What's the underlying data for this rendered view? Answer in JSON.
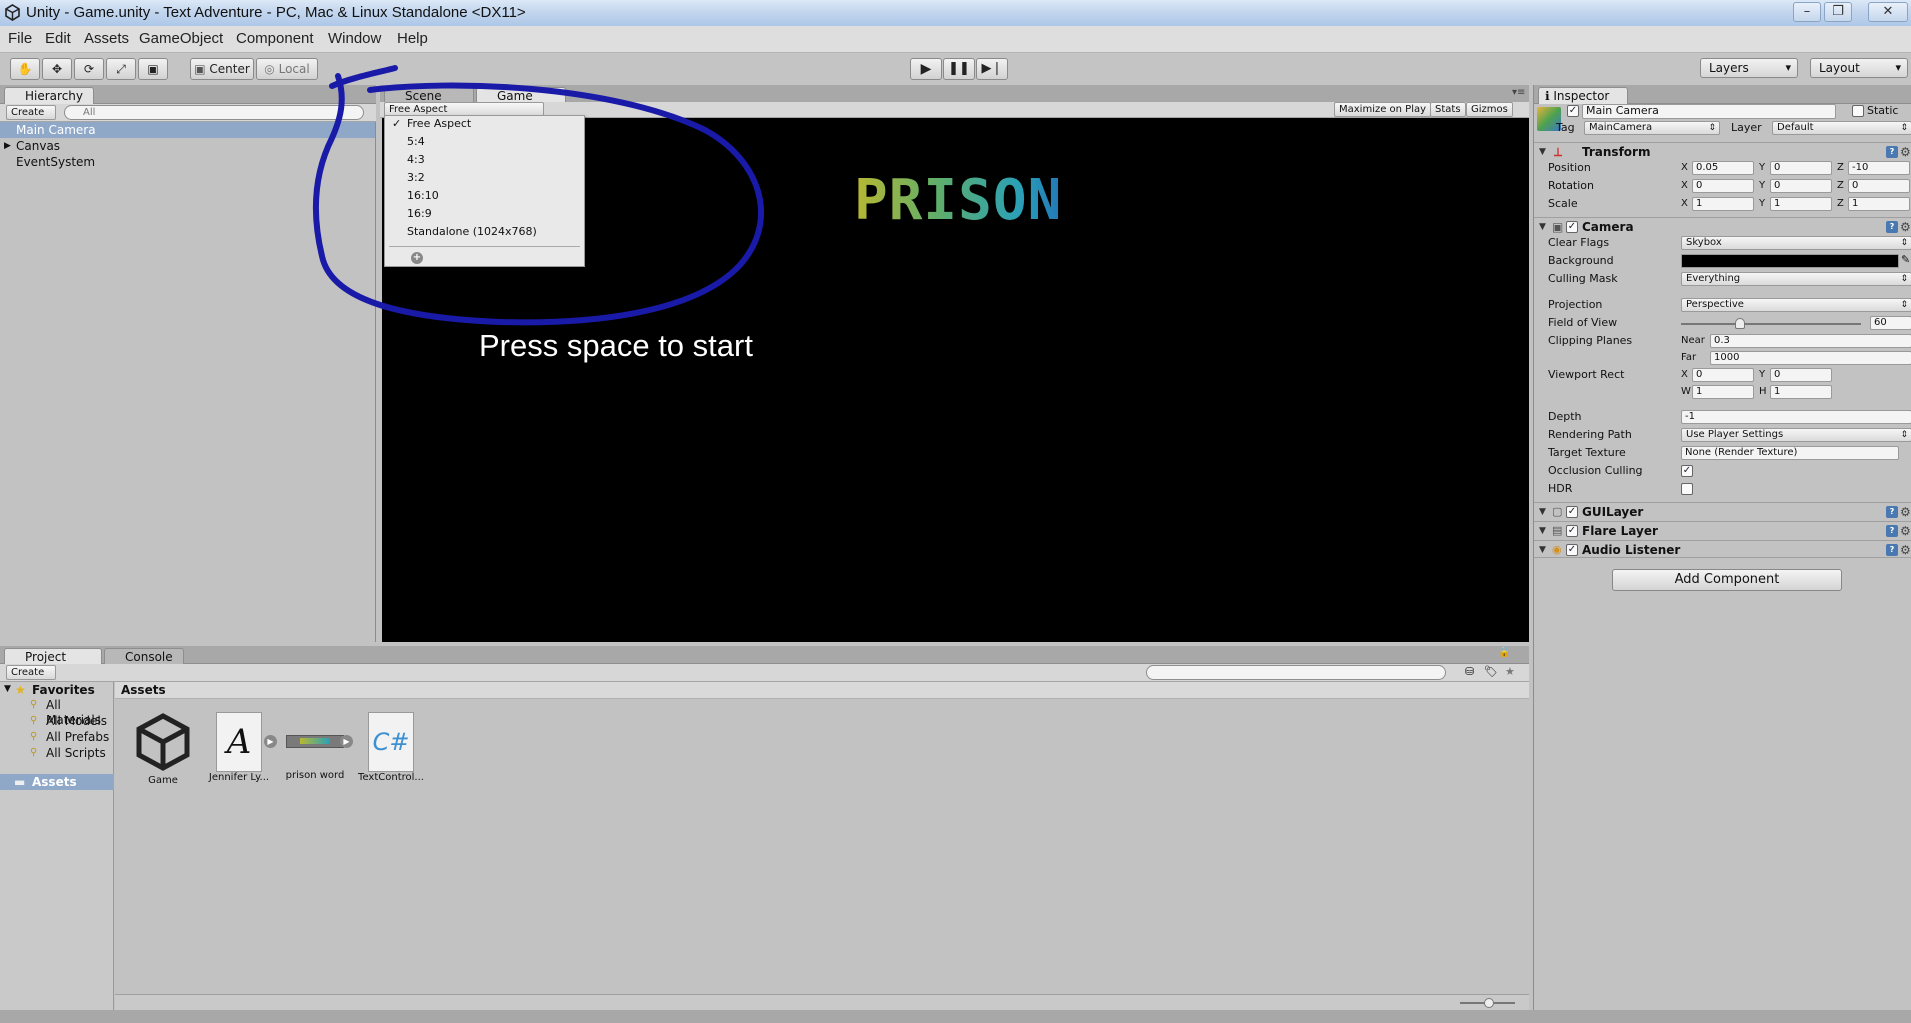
{
  "window": {
    "title": "Unity - Game.unity - Text Adventure - PC, Mac & Linux Standalone <DX11>",
    "minimize": "–",
    "maximize": "❐",
    "close": "✕"
  },
  "menu": [
    "File",
    "Edit",
    "Assets",
    "GameObject",
    "Component",
    "Window",
    "Help"
  ],
  "toolbar": {
    "pivot": "Center",
    "space": "Local",
    "layers": "Layers",
    "layout": "Layout"
  },
  "hierarchy": {
    "tab": "Hierarchy",
    "create": "Create",
    "search_placeholder": "All",
    "items": [
      {
        "label": "Main Camera",
        "selected": true
      },
      {
        "label": "Canvas",
        "expandable": true
      },
      {
        "label": "EventSystem"
      }
    ]
  },
  "game_view": {
    "tabs": [
      "Scene",
      "Game"
    ],
    "aspect": "Free Aspect",
    "buttons": [
      "Maximize on Play",
      "Stats",
      "Gizmos"
    ],
    "aspect_options": [
      "Free Aspect",
      "5:4",
      "4:3",
      "3:2",
      "16:10",
      "16:9",
      "Standalone (1024x768)"
    ],
    "selected_option": "Free Aspect",
    "add_symbol": "+",
    "game_title": "PRISON",
    "game_prompt": "Press space to start"
  },
  "inspector": {
    "tab": "Inspector",
    "object_name": "Main Camera",
    "static_label": "Static",
    "tag_label": "Tag",
    "tag": "MainCamera",
    "layer_label": "Layer",
    "layer": "Default",
    "transform": {
      "title": "Transform",
      "position_label": "Position",
      "rotation_label": "Rotation",
      "scale_label": "Scale",
      "position": [
        "0.05",
        "0",
        "-10"
      ],
      "rotation": [
        "0",
        "0",
        "0"
      ],
      "scale": [
        "1",
        "1",
        "1"
      ]
    },
    "camera": {
      "title": "Camera",
      "clear_flags_label": "Clear Flags",
      "clear_flags": "Skybox",
      "background_label": "Background",
      "background_color": "#000000",
      "culling_mask_label": "Culling Mask",
      "culling_mask": "Everything",
      "projection_label": "Projection",
      "projection": "Perspective",
      "fov_label": "Field of View",
      "fov": "60",
      "fov_slider_fraction": 0.33,
      "clipping_label": "Clipping Planes",
      "near_label": "Near",
      "near": "0.3",
      "far_label": "Far",
      "far": "1000",
      "viewport_label": "Viewport Rect",
      "viewport": {
        "x": "0",
        "y": "0",
        "w": "1",
        "h": "1"
      },
      "depth_label": "Depth",
      "depth": "-1",
      "rendering_path_label": "Rendering Path",
      "rendering_path": "Use Player Settings",
      "target_texture_label": "Target Texture",
      "target_texture": "None (Render Texture)",
      "occlusion_label": "Occlusion Culling",
      "occlusion": true,
      "hdr_label": "HDR",
      "hdr": false
    },
    "components": [
      "GUILayer",
      "Flare Layer",
      "Audio Listener"
    ],
    "add_component": "Add Component"
  },
  "project": {
    "tabs": [
      "Project",
      "Console"
    ],
    "create": "Create",
    "favorites_label": "Favorites",
    "favorites": [
      "All Materials",
      "All Models",
      "All Prefabs",
      "All Scripts"
    ],
    "assets_label": "Assets",
    "breadcrumb": "Assets",
    "assets": [
      {
        "name": "Game",
        "icon": "unity-scene-icon"
      },
      {
        "name": "Jennifer Ly...",
        "icon": "font-icon"
      },
      {
        "name": "prison word",
        "icon": "sprite-icon"
      },
      {
        "name": "TextControl...",
        "icon": "csharp-script-icon"
      }
    ]
  },
  "axis_labels": {
    "x": "X",
    "y": "Y",
    "z": "Z",
    "w": "W",
    "h": "H"
  },
  "annotation": {
    "color": "#1a1aa8"
  }
}
